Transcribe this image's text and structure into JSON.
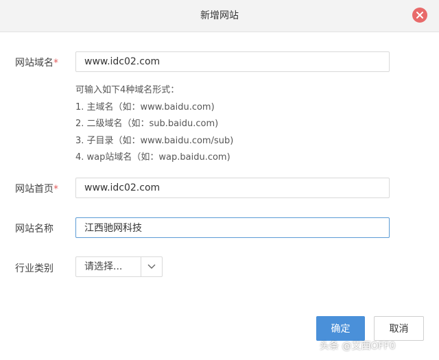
{
  "dialog": {
    "title": "新增网站",
    "close_icon": "close-icon"
  },
  "form": {
    "domain": {
      "label": "网站域名",
      "required_mark": "*",
      "value": "www.idc02.com",
      "hint_title": "可输入如下4种域名形式：",
      "hints": [
        "1. 主域名（如：www.baidu.com)",
        "2. 二级域名（如：sub.baidu.com)",
        "3. 子目录（如：www.baidu.com/sub)",
        "4. wap站域名（如：wap.baidu.com)"
      ]
    },
    "homepage": {
      "label": "网站首页",
      "required_mark": "*",
      "value": "www.idc02.com"
    },
    "site_name": {
      "label": "网站名称",
      "value": "江西驰网科技"
    },
    "industry": {
      "label": "行业类别",
      "selected": "请选择...",
      "arrow_icon": "chevron-down-icon"
    }
  },
  "buttons": {
    "ok": "确定",
    "cancel": "取消"
  },
  "watermark": "头条 @艾西OFF0",
  "colors": {
    "title_bar": "#f3f3f3",
    "close": "#e86a6a",
    "required": "#e35d5d",
    "primary": "#4a90d9",
    "focus_border": "#5b9bd5"
  }
}
